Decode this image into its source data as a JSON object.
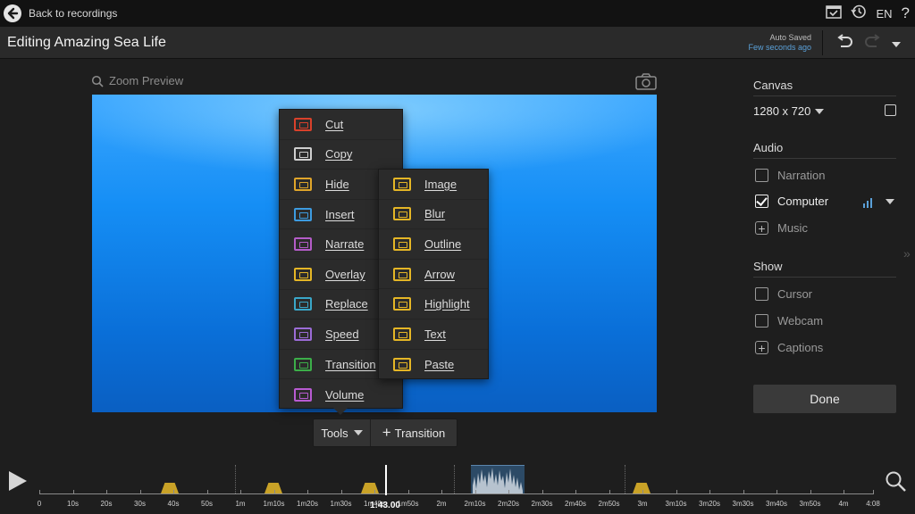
{
  "topbar": {
    "back_label": "Back to recordings",
    "language": "EN",
    "help": "?"
  },
  "titlebar": {
    "title": "Editing Amazing Sea Life",
    "autosave_status": "Auto Saved",
    "autosave_time": "Few seconds ago"
  },
  "preview": {
    "zoom_label": "Zoom Preview"
  },
  "tools_menu": [
    {
      "label": "Cut",
      "color": "#d9412b"
    },
    {
      "label": "Copy",
      "color": "#cfcfcf"
    },
    {
      "label": "Hide",
      "color": "#e0a52a"
    },
    {
      "label": "Insert",
      "color": "#3d9be0"
    },
    {
      "label": "Narrate",
      "color": "#b45cc8"
    },
    {
      "label": "Overlay",
      "color": "#e5b626"
    },
    {
      "label": "Replace",
      "color": "#3aa7c9"
    },
    {
      "label": "Speed",
      "color": "#9b6cd6"
    },
    {
      "label": "Transition",
      "color": "#3cae49"
    },
    {
      "label": "Volume",
      "color": "#b85bd2"
    }
  ],
  "overlay_menu": [
    {
      "label": "Image",
      "color": "#e5b626"
    },
    {
      "label": "Blur",
      "color": "#e5b626"
    },
    {
      "label": "Outline",
      "color": "#e5b626"
    },
    {
      "label": "Arrow",
      "color": "#e5b626"
    },
    {
      "label": "Highlight",
      "color": "#e5b626"
    },
    {
      "label": "Text",
      "color": "#e5b626"
    },
    {
      "label": "Paste",
      "color": "#e5b626"
    }
  ],
  "toolbar": {
    "tools_label": "Tools",
    "transition_label": "Transition"
  },
  "panel": {
    "canvas_heading": "Canvas",
    "canvas_size": "1280 x 720",
    "audio_heading": "Audio",
    "audio_options": [
      {
        "label": "Narration",
        "checked": false
      },
      {
        "label": "Computer",
        "checked": true
      },
      {
        "label": "Music",
        "checked": false
      }
    ],
    "show_heading": "Show",
    "show_options": [
      {
        "label": "Cursor",
        "checked": false
      },
      {
        "label": "Webcam",
        "checked": false
      },
      {
        "label": "Captions",
        "checked": false
      }
    ],
    "done_label": "Done"
  },
  "timeline": {
    "playhead_time": "1:43.00",
    "tick_labels": [
      "0",
      "10s",
      "20s",
      "30s",
      "40s",
      "50s",
      "1m",
      "1m10s",
      "1m20s",
      "1m30s",
      "1m40s",
      "1m50s",
      "2m",
      "2m10s",
      "2m20s",
      "2m30s",
      "2m40s",
      "2m50s",
      "3m",
      "3m10s",
      "3m20s",
      "3m30s",
      "3m40s",
      "3m50s",
      "4m",
      "4:08"
    ]
  }
}
